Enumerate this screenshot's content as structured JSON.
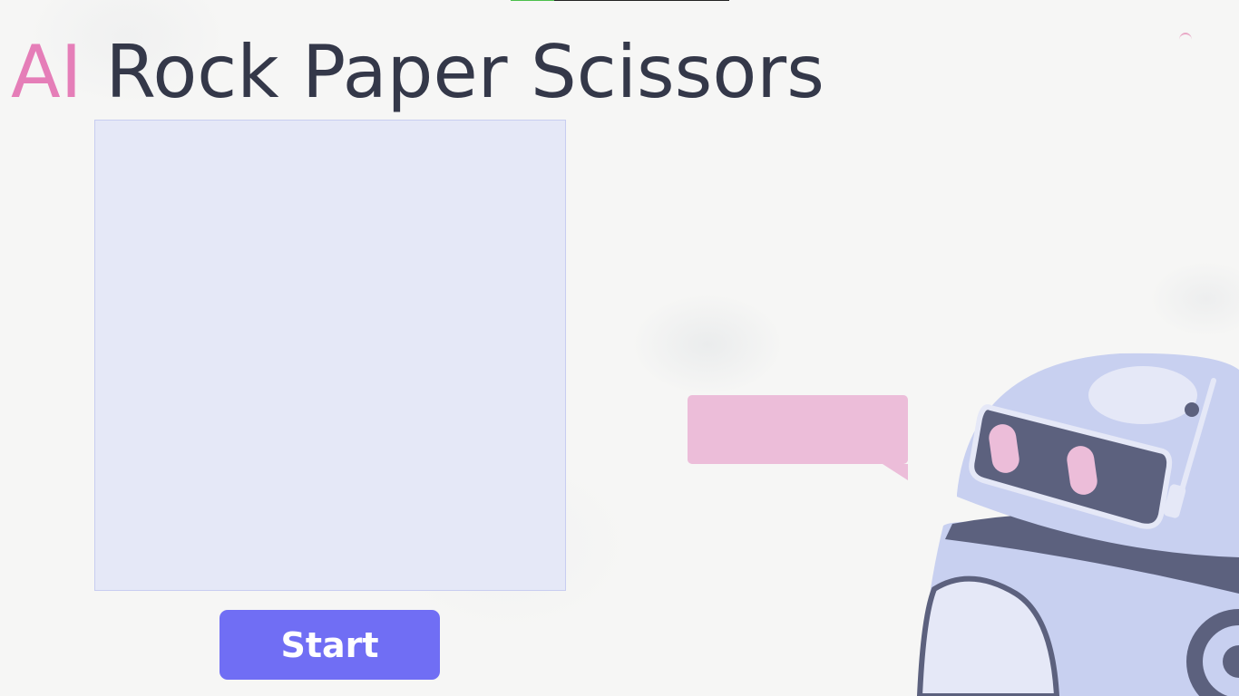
{
  "page": {
    "title_accent": "AI",
    "title_main": "Rock Paper Scissors"
  },
  "controls": {
    "start_label": "Start"
  },
  "robot": {
    "speech_text": ""
  },
  "loading": {
    "progress": 0.2
  },
  "colors": {
    "accent": "#e57eb8",
    "title": "#343849",
    "button": "#706ef4",
    "panel": "#e5e8f7",
    "bubble": "#ecbdd9",
    "robot_body": "#c8d0f0",
    "robot_dark": "#5c617e"
  },
  "icons": {
    "mascot": "robot-mascot"
  }
}
